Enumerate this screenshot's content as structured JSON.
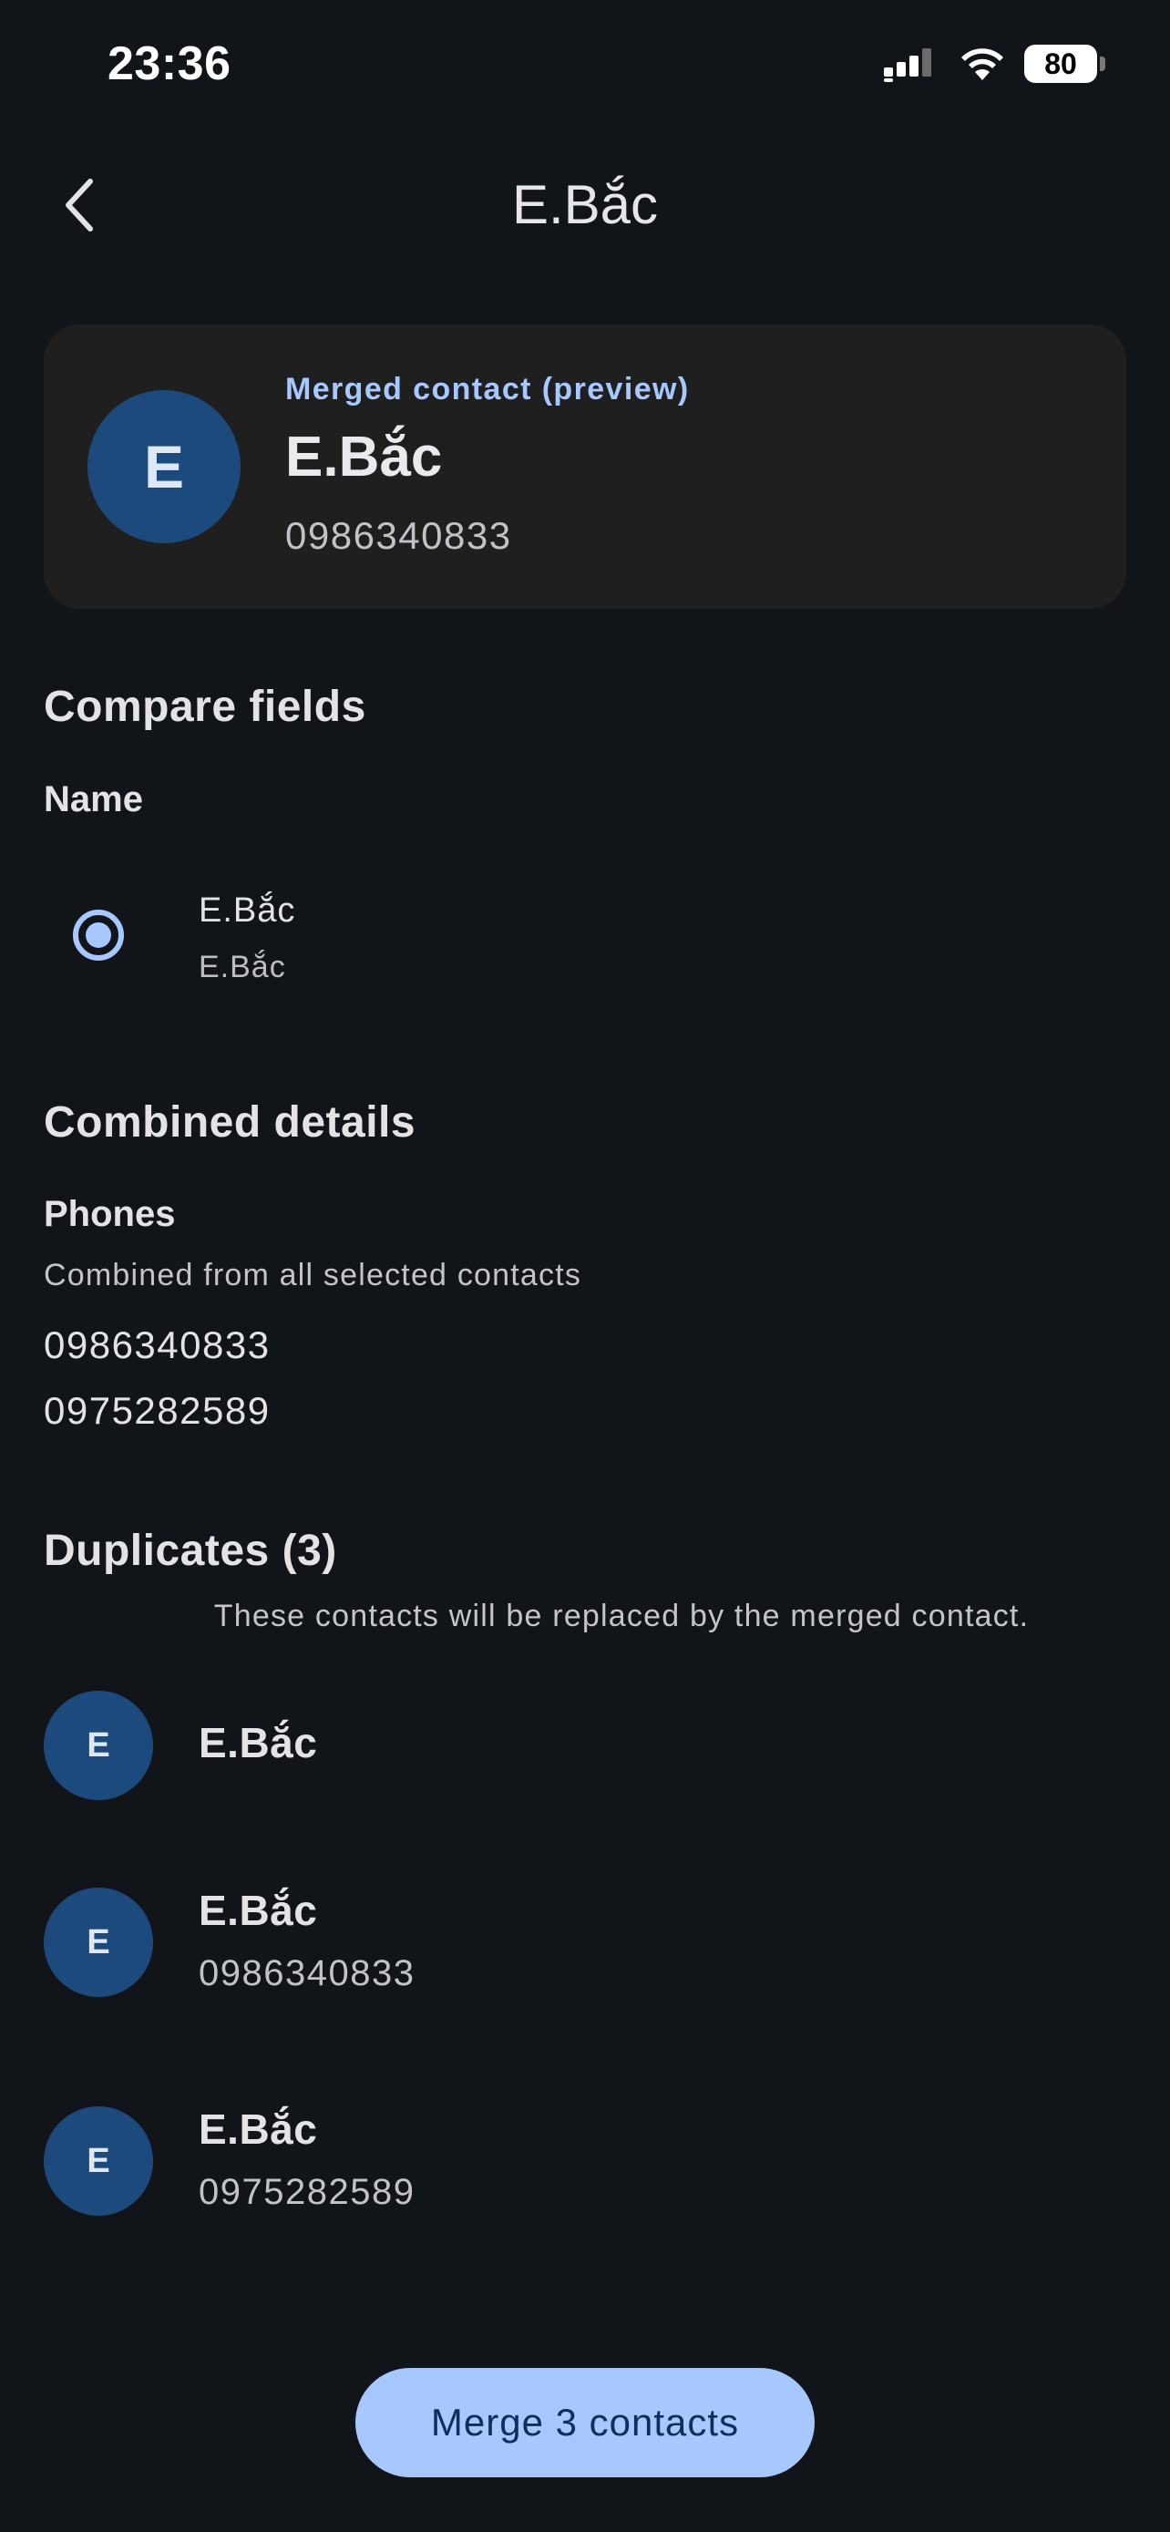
{
  "status_bar": {
    "time": "23:36",
    "battery": "80"
  },
  "app_bar": {
    "title": "E.Bắc"
  },
  "preview": {
    "label": "Merged contact (preview)",
    "initial": "E",
    "name": "E.Bắc",
    "phone": "0986340833"
  },
  "compare": {
    "title": "Compare fields",
    "name_label": "Name",
    "option": {
      "primary": "E.Bắc",
      "secondary": "E.Bắc",
      "selected": true
    }
  },
  "combined": {
    "title": "Combined details",
    "phones_label": "Phones",
    "phones_subtitle": "Combined from all selected contacts",
    "phones": [
      "0986340833",
      "0975282589"
    ]
  },
  "duplicates": {
    "title": "Duplicates (3)",
    "subtitle": "These contacts will be replaced by the merged contact.",
    "items": [
      {
        "initial": "E",
        "name": "E.Bắc",
        "phone": ""
      },
      {
        "initial": "E",
        "name": "E.Bắc",
        "phone": "0986340833"
      },
      {
        "initial": "E",
        "name": "E.Bắc",
        "phone": "0975282589"
      }
    ]
  },
  "merge_button": {
    "label": "Merge 3 contacts"
  },
  "colors": {
    "background": "#111419",
    "card": "#1f1f20",
    "accent": "#a6c8ff",
    "avatar": "#1c4a7c"
  }
}
